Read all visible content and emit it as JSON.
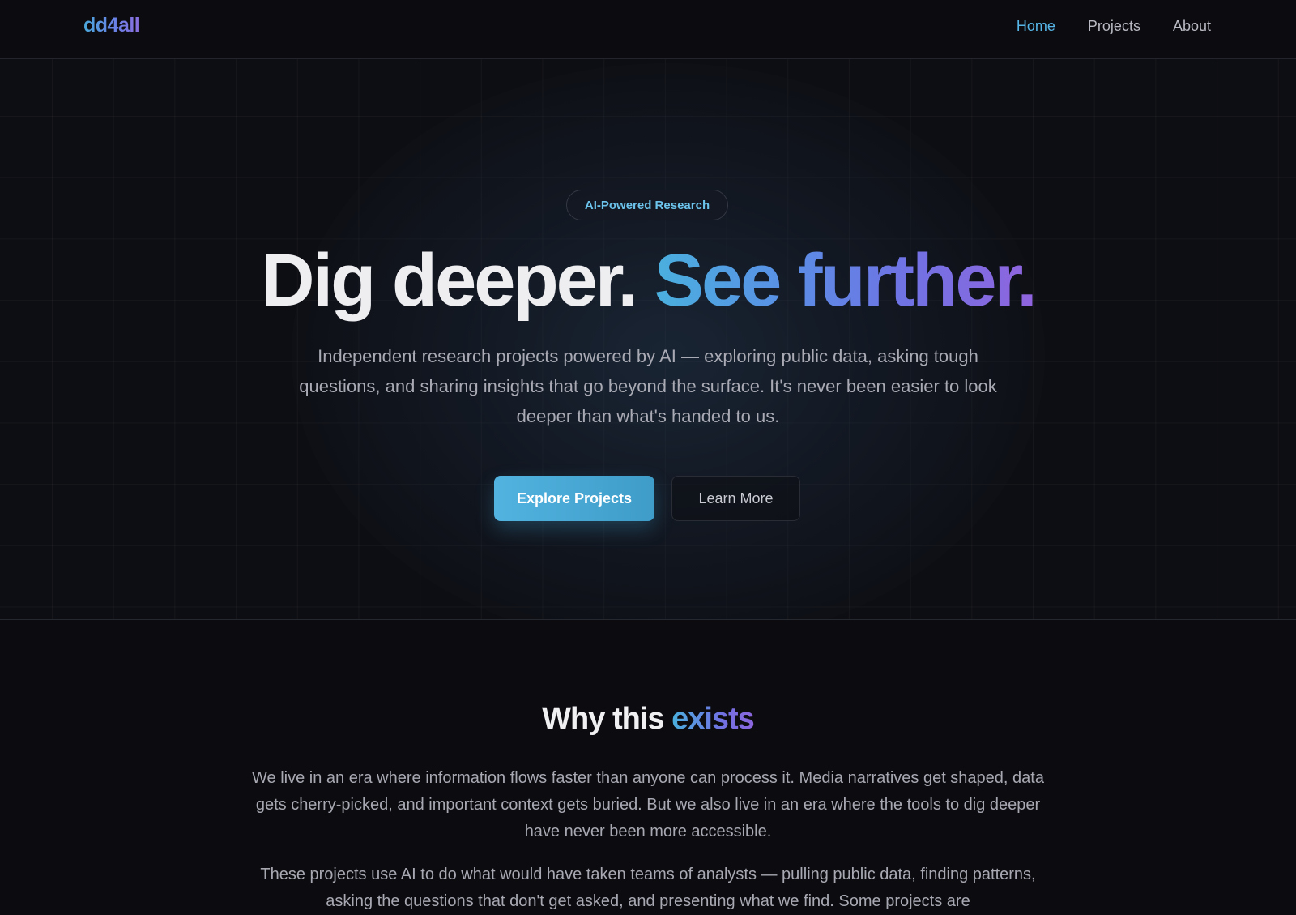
{
  "nav": {
    "logo": "dd4all",
    "links": [
      {
        "label": "Home",
        "active": true
      },
      {
        "label": "Projects",
        "active": false
      },
      {
        "label": "About",
        "active": false
      }
    ]
  },
  "hero": {
    "badge": "AI-Powered Research",
    "headline_plain": "Dig deeper.",
    "headline_gradient": "See further.",
    "subtitle": "Independent research projects powered by AI — exploring public data, asking tough questions, and sharing insights that go beyond the surface. It's never been easier to look deeper than what's handed to us.",
    "primary_button": "Explore Projects",
    "secondary_button": "Learn More"
  },
  "why": {
    "title_plain": "Why this",
    "title_accent": "exists",
    "paragraphs": [
      "We live in an era where information flows faster than anyone can process it. Media narratives get shaped, data gets cherry-picked, and important context gets buried. But we also live in an era where the tools to dig deeper have never been more accessible.",
      "These projects use AI to do what would have taken teams of analysts — pulling public data, finding patterns, asking the questions that don't get asked, and presenting what we find. Some projects are"
    ]
  },
  "colors": {
    "background": "#0c0c10",
    "accent_blue": "#56b6e8",
    "accent_purple": "#8b6fe0",
    "text_muted": "#a9aab4"
  }
}
